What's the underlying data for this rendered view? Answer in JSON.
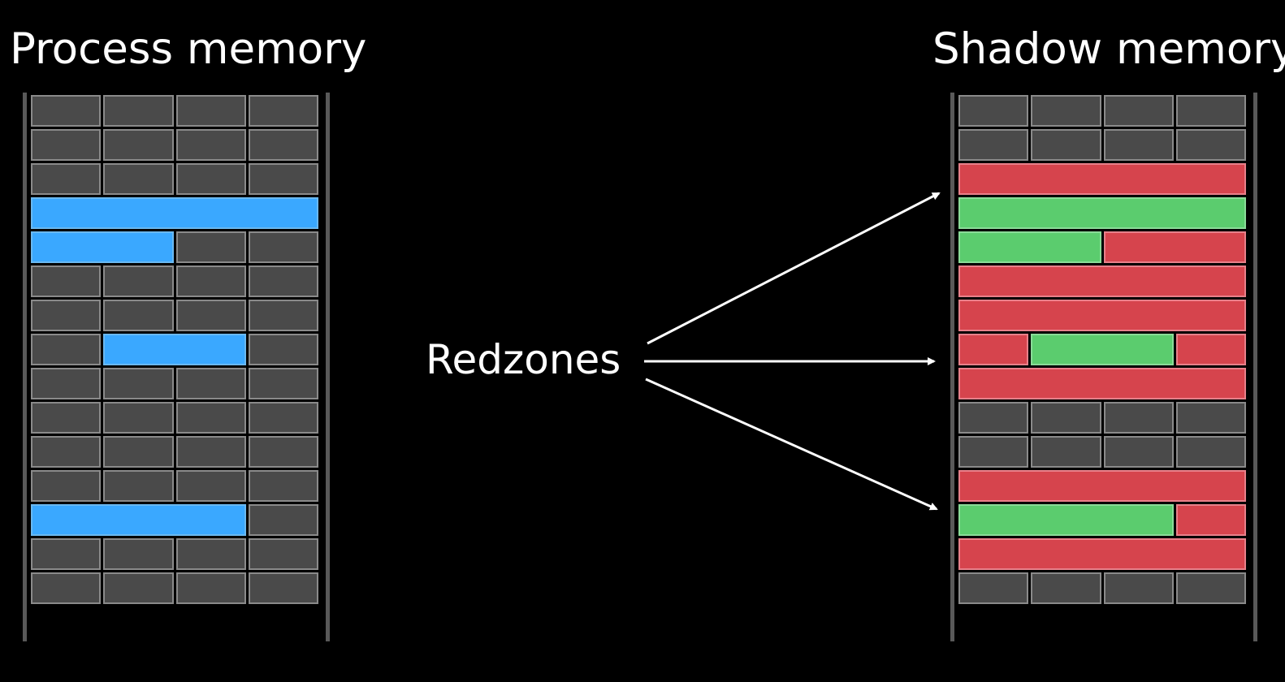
{
  "labels": {
    "left_title": "Process memory",
    "right_title": "Shadow memory",
    "center_label": "Redzones"
  },
  "colors": {
    "background": "#000000",
    "cell_gray": "#4a4a4a",
    "allocation_blue": "#3aa8ff",
    "redzone_red": "#d6444d",
    "valid_green": "#5bcc6e"
  },
  "process_memory": {
    "rows": [
      [
        "gray",
        "gray",
        "gray",
        "gray"
      ],
      [
        "gray",
        "gray",
        "gray",
        "gray"
      ],
      [
        "gray",
        "gray",
        "gray",
        "gray"
      ],
      [
        "blue",
        "blue",
        "blue",
        "blue"
      ],
      [
        "blue",
        "blue",
        "gray",
        "gray"
      ],
      [
        "gray",
        "gray",
        "gray",
        "gray"
      ],
      [
        "gray",
        "gray",
        "gray",
        "gray"
      ],
      [
        "gray",
        "blue",
        "blue",
        "gray"
      ],
      [
        "gray",
        "gray",
        "gray",
        "gray"
      ],
      [
        "gray",
        "gray",
        "gray",
        "gray"
      ],
      [
        "gray",
        "gray",
        "gray",
        "gray"
      ],
      [
        "gray",
        "gray",
        "gray",
        "gray"
      ],
      [
        "blue",
        "blue",
        "blue",
        "gray"
      ],
      [
        "gray",
        "gray",
        "gray",
        "gray"
      ],
      [
        "gray",
        "gray",
        "gray",
        "gray"
      ]
    ]
  },
  "shadow_memory": {
    "rows": [
      [
        "gray",
        "gray",
        "gray",
        "gray"
      ],
      [
        "gray",
        "gray",
        "gray",
        "gray"
      ],
      [
        "red",
        "red",
        "red",
        "red"
      ],
      [
        "green",
        "green",
        "green",
        "green"
      ],
      [
        "green",
        "green",
        "red",
        "red"
      ],
      [
        "red",
        "red",
        "red",
        "red"
      ],
      [
        "red",
        "red",
        "red",
        "red"
      ],
      [
        "red",
        "green",
        "green",
        "red"
      ],
      [
        "red",
        "red",
        "red",
        "red"
      ],
      [
        "gray",
        "gray",
        "gray",
        "gray"
      ],
      [
        "gray",
        "gray",
        "gray",
        "gray"
      ],
      [
        "red",
        "red",
        "red",
        "red"
      ],
      [
        "green",
        "green",
        "green",
        "red"
      ],
      [
        "red",
        "red",
        "red",
        "red"
      ],
      [
        "gray",
        "gray",
        "gray",
        "gray"
      ]
    ]
  },
  "arrows": [
    {
      "name": "arrow-to-upper-redzone"
    },
    {
      "name": "arrow-to-middle-redzone"
    },
    {
      "name": "arrow-to-lower-redzone"
    }
  ]
}
